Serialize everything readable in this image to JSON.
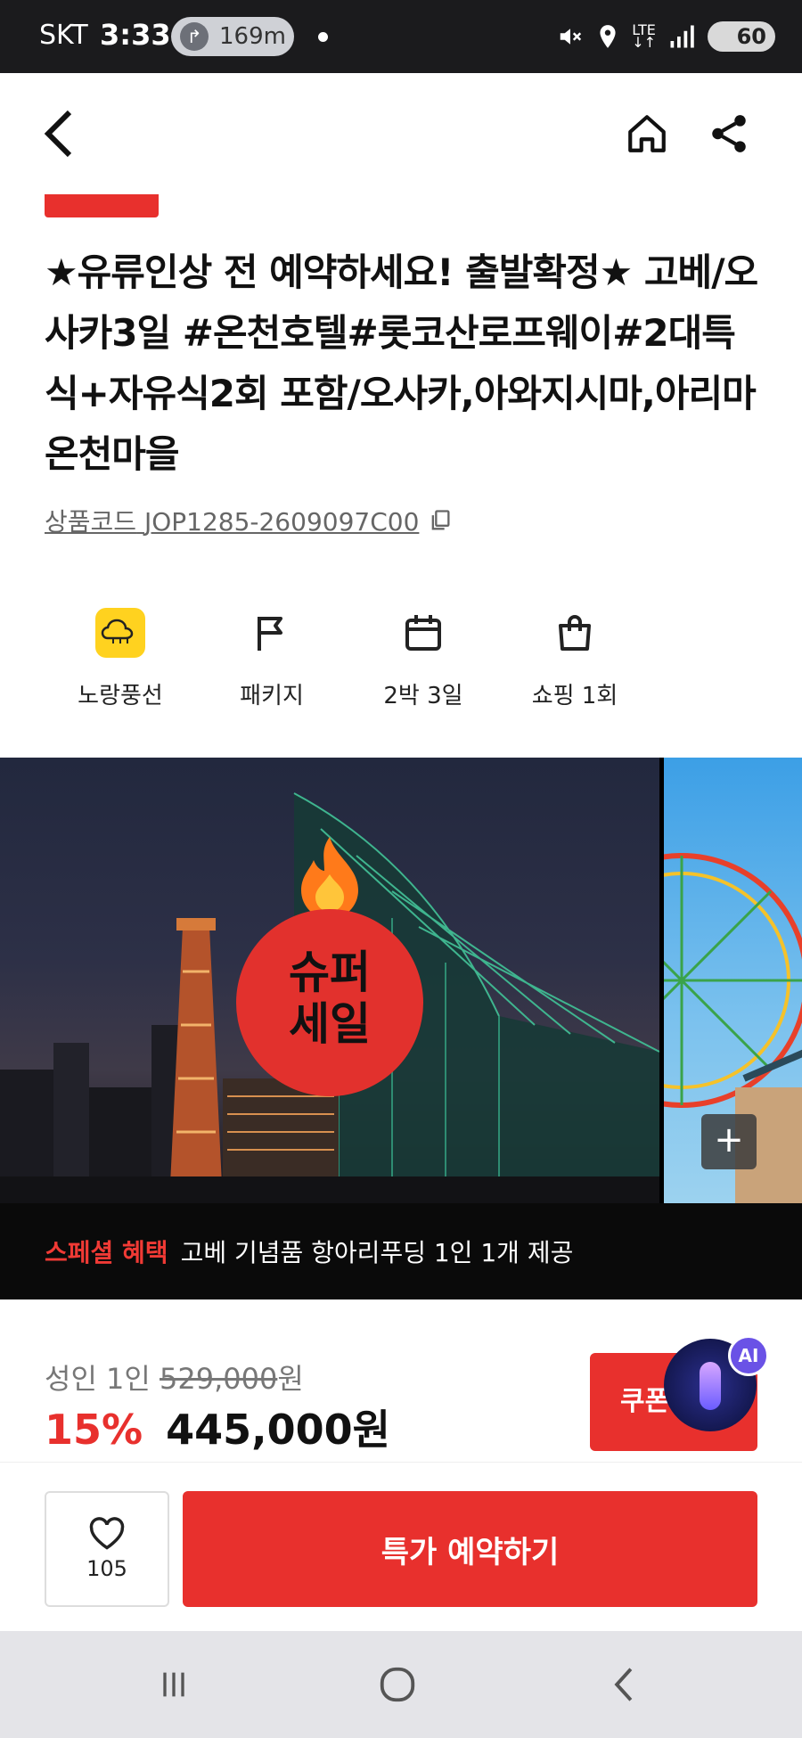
{
  "status_bar": {
    "carrier": "SKT",
    "time": "3:33",
    "nav_distance": "169m",
    "battery": "60",
    "network": "LTE"
  },
  "header": {
    "back_icon": "chevron-left-icon",
    "home_icon": "home-icon",
    "share_icon": "share-icon"
  },
  "product": {
    "title": "★유류인상 전 예약하세요! 출발확정★ 고베/오사카3일 #온천호텔#롯코산로프웨이#2대특식+자유식2회 포함/오사카,아와지시마,아리마온천마을",
    "code_label": "상품코드",
    "code": "JOP1285-2609097C00"
  },
  "features": [
    {
      "label": "노랑풍선",
      "icon": "balloon-logo-icon"
    },
    {
      "label": "패키지",
      "icon": "flag-icon"
    },
    {
      "label": "2박 3일",
      "icon": "calendar-icon"
    },
    {
      "label": "쇼핑 1회",
      "icon": "shopping-bag-icon"
    }
  ],
  "gallery": {
    "sale_line1": "슈퍼",
    "sale_line2": "세일",
    "plus": "+"
  },
  "benefit": {
    "label": "스페셜 혜택",
    "text": "고베 기념품 항아리푸딩 1인 1개 제공"
  },
  "price": {
    "per_label": "성인 1인",
    "original": "529,000",
    "unit": "원",
    "discount": "15%",
    "current": "445,000원",
    "coupon_label": "쿠폰",
    "ai_badge": "AI"
  },
  "cta": {
    "like_count": "105",
    "book_label": "특가 예약하기"
  }
}
